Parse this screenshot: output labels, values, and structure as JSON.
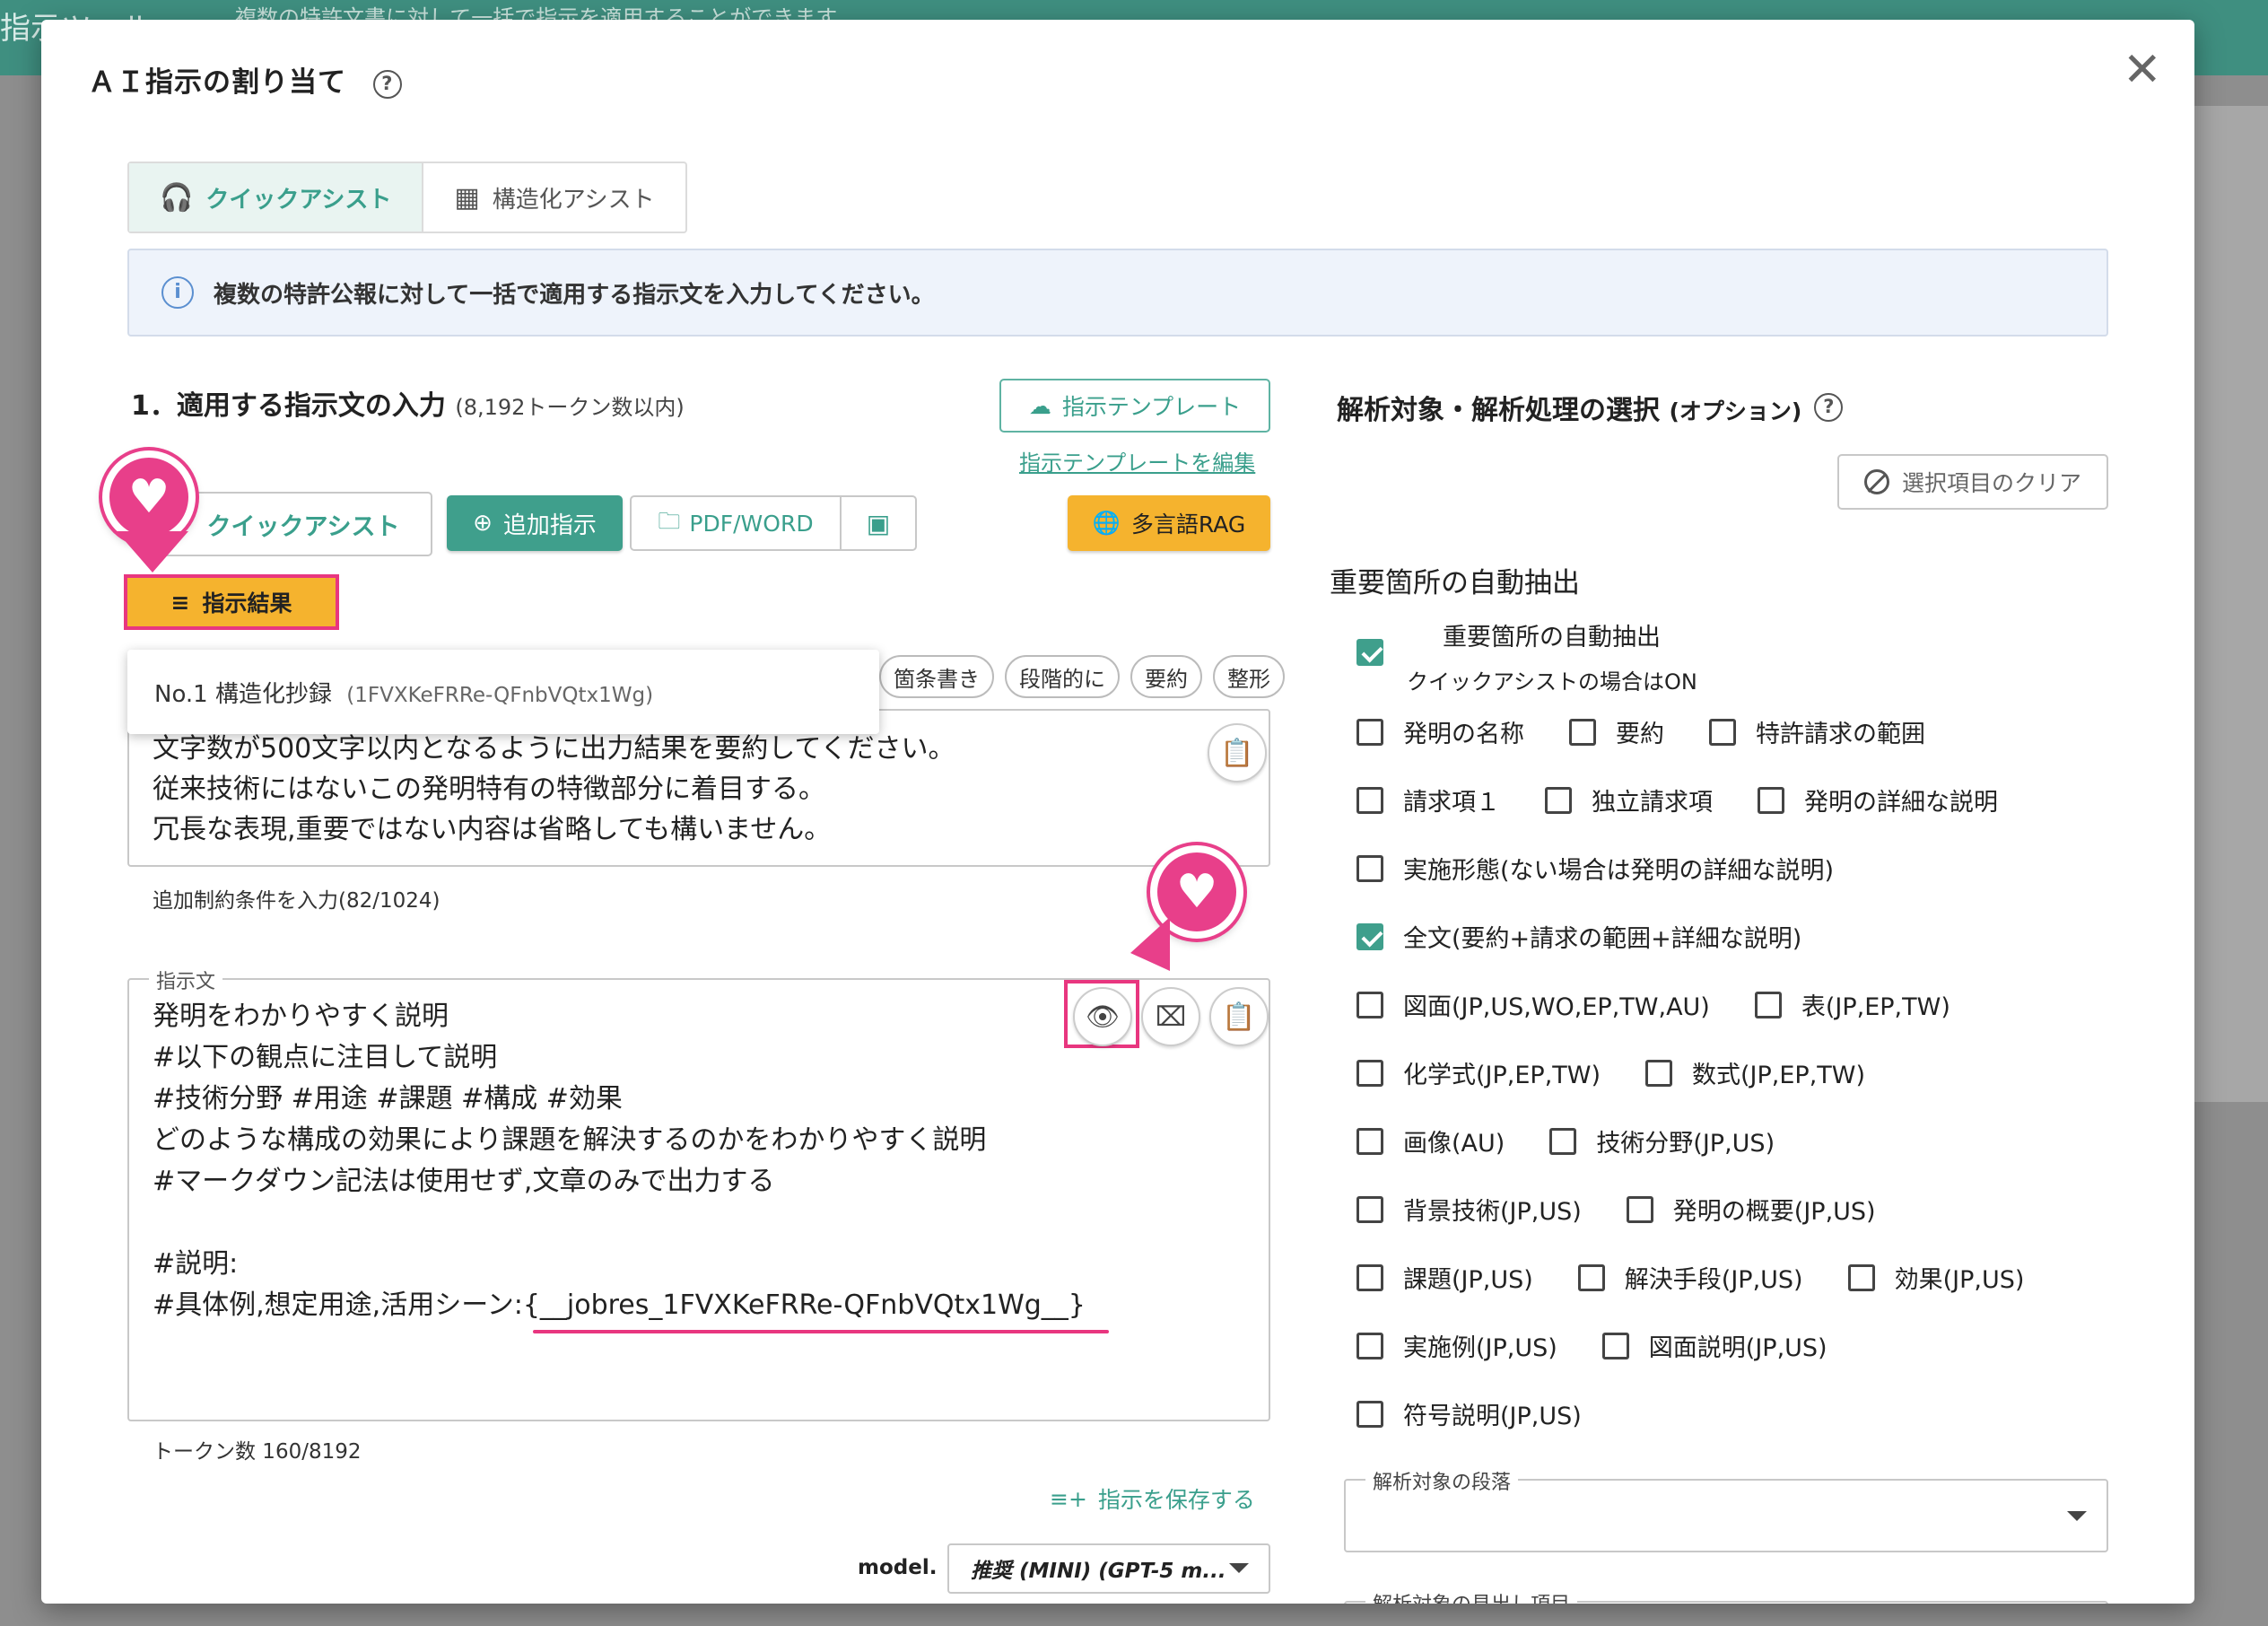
{
  "background": {
    "title": "指示ツール",
    "subtitle": "複数の特許文書に対して一括で指示を適用することができます"
  },
  "modal": {
    "title": "ＡＩ指示の割り当て",
    "help": "?",
    "close": "✕"
  },
  "tabs": [
    {
      "label": "クイックアシスト",
      "active": true
    },
    {
      "label": "構造化アシスト",
      "active": false
    }
  ],
  "info": {
    "icon": "i",
    "text": "複数の特許公報に対して一括で適用する指示文を入力してください。"
  },
  "section1": {
    "title": "1．適用する指示文の入力",
    "subtitle": "(8,192トークン数以内)",
    "template_button": "指示テンプレート",
    "template_edit_link": "指示テンプレートを編集",
    "quick_assist_button": "クイックアシスト",
    "add_instruction_button": "追加指示",
    "pdf_word_button": "PDF/WORD",
    "rag_button": "多言語RAG",
    "result_button": "指示結果",
    "dropdown_item": {
      "label": "No.1 構造化抄録",
      "id": "(1FVXKeFRRe-QFnbVQtx1Wg)"
    },
    "chips": [
      "箇条書き",
      "段階的に",
      "要約",
      "整形"
    ],
    "constraint_lines": [
      "文字数が500文字以内となるように出力結果を要約してください。",
      "従来技術にはないこの発明特有の特徴部分に着目する。",
      "冗長な表現,重要ではない内容は省略しても構いません。"
    ],
    "constraint_hint": "追加制約条件を入力(82/1024)",
    "instruction_label": "指示文",
    "instruction_text": "発明をわかりやすく説明\n#以下の観点に注目して説明\n#技術分野 #用途 #課題 #構成 #効果\nどのような構成の効果により課題を解決するのかをわかりやすく説明\n#マークダウン記法は使用せず,文章のみで出力する\n\n#説明:\n#具体例,想定用途,活用シーン:{__jobres_1FVXKeFRRe-QFnbVQtx1Wg__}",
    "token_count": "トークン数 160/8192",
    "save_button": "指示を保存する",
    "model_label": "model.",
    "model_value": "推奨 (MINI) (GPT-5 m..."
  },
  "section2": {
    "title": "解析対象・解析処理の選択",
    "title_option": "(オプション)",
    "clear_button": "選択項目のクリア",
    "group_title": "重要箇所の自動抽出",
    "auto_extract": {
      "label": "重要箇所の自動抽出",
      "sub": "クイックアシストの場合はON",
      "checked": true
    },
    "rows": [
      [
        {
          "label": "発明の名称",
          "checked": false
        },
        {
          "label": "要約",
          "checked": false
        },
        {
          "label": "特許請求の範囲",
          "checked": false
        }
      ],
      [
        {
          "label": "請求項１",
          "checked": false
        },
        {
          "label": "独立請求項",
          "checked": false
        },
        {
          "label": "発明の詳細な説明",
          "checked": false
        }
      ],
      [
        {
          "label": "実施形態(ない場合は発明の詳細な説明)",
          "checked": false
        }
      ],
      [
        {
          "label": "全文(要約+請求の範囲+詳細な説明)",
          "checked": true
        }
      ],
      [
        {
          "label": "図面(JP,US,WO,EP,TW,AU)",
          "checked": false
        },
        {
          "label": "表(JP,EP,TW)",
          "checked": false
        }
      ],
      [
        {
          "label": "化学式(JP,EP,TW)",
          "checked": false
        },
        {
          "label": "数式(JP,EP,TW)",
          "checked": false
        }
      ],
      [
        {
          "label": "画像(AU)",
          "checked": false
        },
        {
          "label": "技術分野(JP,US)",
          "checked": false
        }
      ],
      [
        {
          "label": "背景技術(JP,US)",
          "checked": false
        },
        {
          "label": "発明の概要(JP,US)",
          "checked": false
        }
      ],
      [
        {
          "label": "課題(JP,US)",
          "checked": false
        },
        {
          "label": "解決手段(JP,US)",
          "checked": false
        },
        {
          "label": "効果(JP,US)",
          "checked": false
        }
      ],
      [
        {
          "label": "実施例(JP,US)",
          "checked": false
        },
        {
          "label": "図面説明(JP,US)",
          "checked": false
        }
      ],
      [
        {
          "label": "符号説明(JP,US)",
          "checked": false
        }
      ]
    ],
    "paragraph_field_label": "解析対象の段落",
    "heading_field_label": "解析対象の見出し項目"
  },
  "colors": {
    "accent": "#3f9f8c",
    "highlight": "#e8367f",
    "warning": "#f5b32e"
  }
}
